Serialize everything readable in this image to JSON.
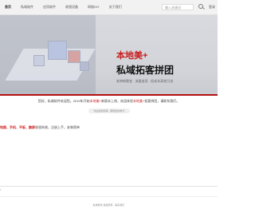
{
  "nav": {
    "items": [
      "首页",
      "私域软件",
      "应用软件",
      "收银设备",
      "网络DIY",
      "关于我们"
    ],
    "search_placeholder": "输入关键词",
    "login": "登录"
  },
  "banner": {
    "brand": "本地美+",
    "title": "私域拓客拼团",
    "subtitle": "老带新裂变 · 流量变现 · 低成本高效引流"
  },
  "notice": {
    "prefix": "您好，私域软件欢迎您。2019年开始",
    "highlight1": "本地美+",
    "middle": "新版本上线，欢迎体验",
    "highlight2": "本地美+",
    "suffix": "拓客拼团，请联系我们。"
  },
  "tag": "欢迎您的到来 · 期待您的参与",
  "categories": {
    "red": "地图、手机、平板、触屏",
    "rest": "收银系统，注册上手，安装简单"
  },
  "side_glyph": "›",
  "footer": "私域软件 版权所有 · 联系我们"
}
